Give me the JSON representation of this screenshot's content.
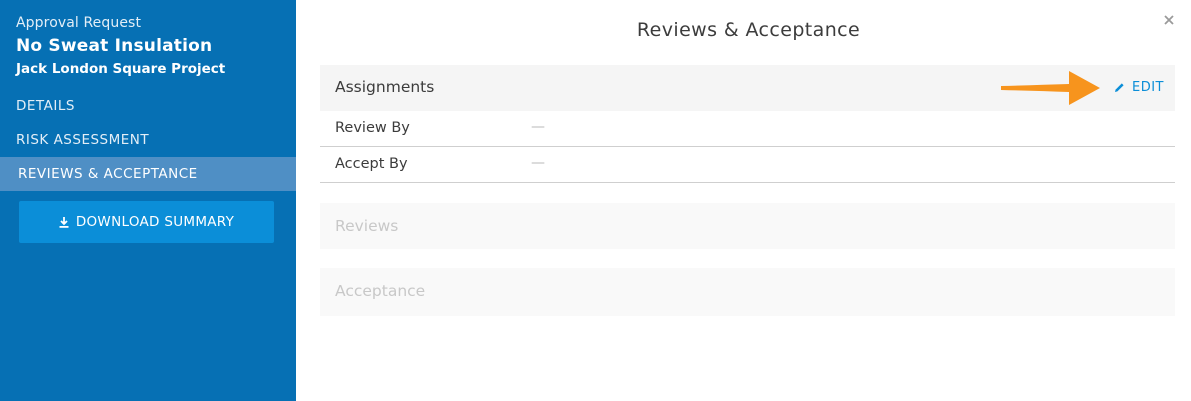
{
  "sidebar": {
    "kicker": "Approval Request",
    "title": "No Sweat Insulation",
    "subtitle": "Jack London Square Project",
    "nav": [
      {
        "label": "DETAILS"
      },
      {
        "label": "RISK ASSESSMENT"
      },
      {
        "label": "REVIEWS & ACCEPTANCE",
        "active": true
      }
    ],
    "download_label": "DOWNLOAD SUMMARY",
    "download_icon": "download-icon"
  },
  "main": {
    "title": "Reviews & Acceptance",
    "close_icon": "close-icon",
    "assignments": {
      "title": "Assignments",
      "edit_label": "EDIT",
      "edit_icon": "pencil-icon",
      "rows": [
        {
          "label": "Review By",
          "value": "—"
        },
        {
          "label": "Accept By",
          "value": "—"
        }
      ]
    },
    "sections": [
      {
        "title": "Reviews"
      },
      {
        "title": "Acceptance"
      }
    ]
  },
  "annotation": {
    "arrow_icon": "arrow-right-icon"
  },
  "colors": {
    "sidebar_bg": "#0670b4",
    "active_nav_bg": "#4f8fc5",
    "button_bg": "#0b8ed8",
    "link": "#0b8ed8",
    "annotation_arrow": "#f7941d"
  }
}
